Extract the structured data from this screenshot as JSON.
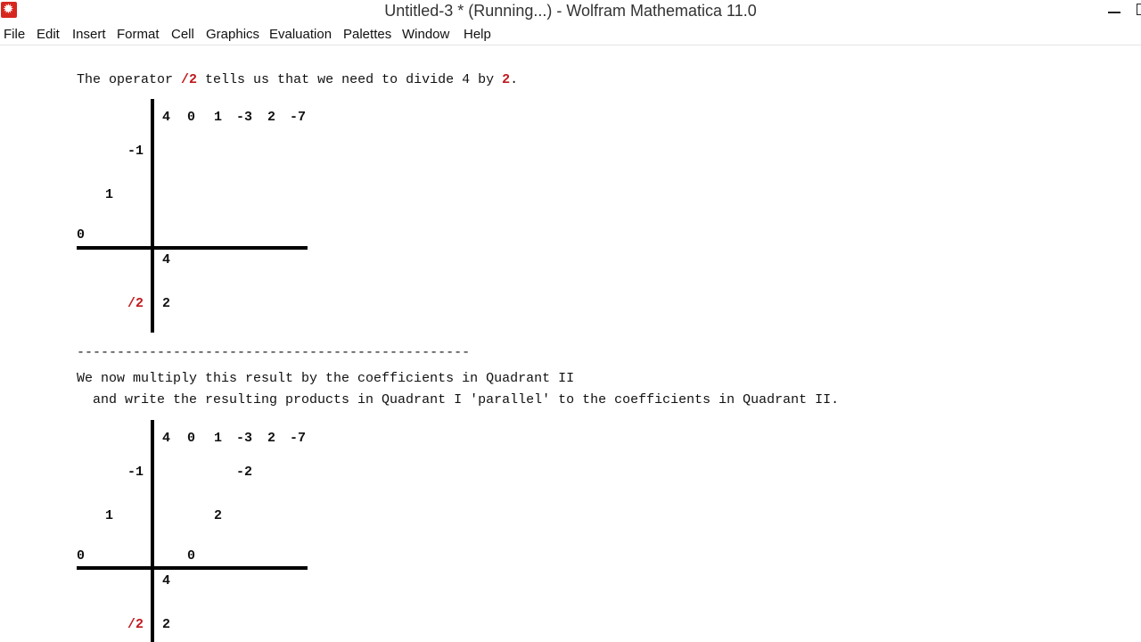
{
  "window": {
    "title": "Untitled-3 * (Running...) - Wolfram Mathematica 11.0"
  },
  "menu": [
    "File",
    "Edit",
    "Insert",
    "Format",
    "Cell",
    "Graphics",
    "Evaluation",
    "Palettes",
    "Window",
    "Help"
  ],
  "section1": {
    "text_before": "The operator ",
    "operator": "/2",
    "text_mid": " tells us that we need to divide 4 by ",
    "divisor": "2",
    "text_end": "."
  },
  "diagram1": {
    "coefficients": [
      "4",
      "0",
      "1",
      "-3",
      "2",
      "-7"
    ],
    "left_labels": [
      "-1",
      "1",
      "0"
    ],
    "quadrant1_entries": [],
    "result": "4",
    "operator": "/2",
    "quotient": "2"
  },
  "separator": "-------------------------------------------------",
  "section2": {
    "line1": "We now multiply this result by the coefficients in Quadrant II",
    "line2": "  and write the resulting products in Quadrant I 'parallel' to the coefficients in Quadrant II."
  },
  "diagram2": {
    "coefficients": [
      "4",
      "0",
      "1",
      "-3",
      "2",
      "-7"
    ],
    "left_labels": [
      "-1",
      "1",
      "0"
    ],
    "quadrant1_entries": [
      "-2",
      "2",
      "0"
    ],
    "result": "4",
    "operator": "/2",
    "quotient": "2"
  },
  "colors": {
    "operator": "#c0191d",
    "axis": "#000000",
    "app_icon": "#d6261e"
  }
}
